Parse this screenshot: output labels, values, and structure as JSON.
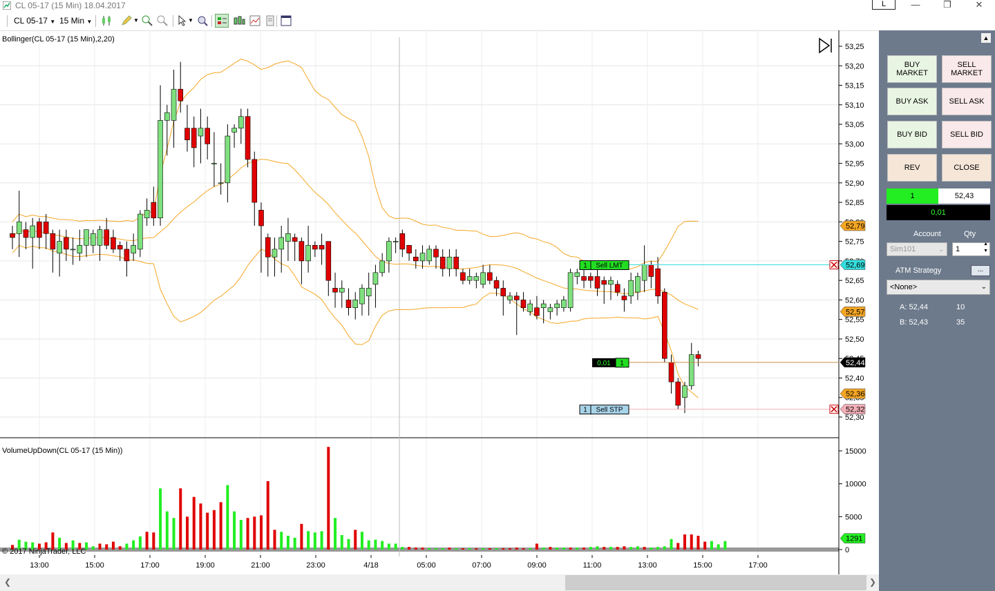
{
  "window": {
    "title": "CL 05-17 (15 Min)  18.04.2017",
    "layout_button": "L",
    "controls": [
      "minimize",
      "maximize",
      "close"
    ]
  },
  "toolbar": {
    "instrument": "CL 05-17",
    "interval": "15 Min",
    "icons": [
      "candlestick-icon",
      "pencil-icon",
      "zoom-in-icon",
      "zoom-out-icon",
      "cursor-icon",
      "magnifier-icon",
      "chart-trader-icon",
      "bars-icon",
      "chart-style-icon",
      "properties-icon",
      "panel-icon"
    ]
  },
  "chart": {
    "price_indicator_label": "Bollinger(CL 05-17 (15 Min),2,20)",
    "volume_indicator_label": "VolumeUpDown(CL 05-17 (15 Min))",
    "copyright": "© 2017 NinjaTrader, LLC",
    "price_ticks": [
      "53,25",
      "53,20",
      "53,15",
      "53,10",
      "53,05",
      "53,00",
      "52,95",
      "52,90",
      "52,85",
      "52,80",
      "52,75",
      "52,70",
      "52,65",
      "52,60",
      "52,55",
      "52,50",
      "52,45",
      "52,40",
      "52,35",
      "52,30"
    ],
    "volume_ticks": [
      "15000",
      "10000",
      "5000",
      "0"
    ],
    "time_ticks": [
      "13:00",
      "15:00",
      "17:00",
      "19:00",
      "21:00",
      "23:00",
      "4/18",
      "05:00",
      "07:00",
      "09:00",
      "11:00",
      "13:00",
      "15:00",
      "17:00"
    ],
    "price_markers": {
      "upper_band": "52,79",
      "sell_limit": "52,69",
      "middle_band": "52,57",
      "last_price": "52,44",
      "lower_band": "52,36",
      "sell_stop": "52,32",
      "volume_last": "1291"
    },
    "orders": {
      "sell_limit": {
        "qty": "1",
        "label": "Sell LMT"
      },
      "sell_stop": {
        "qty": "1",
        "label": "Sell STP"
      },
      "position": {
        "pnl": "0,01",
        "qty": "1"
      }
    },
    "colors": {
      "up": "#7ee07e",
      "down": "#e00000",
      "band": "#f5a623",
      "limit_line": "#33dddd",
      "stop_line": "#f4b0b8",
      "position_line": "#c88a4a"
    }
  },
  "chart_data": {
    "type": "candlestick",
    "price_range": [
      52.27,
      53.29
    ],
    "candles": [
      [
        52.77,
        52.79,
        52.73,
        52.76
      ],
      [
        52.77,
        52.88,
        52.71,
        52.8
      ],
      [
        52.78,
        52.8,
        52.73,
        52.76
      ],
      [
        52.76,
        52.81,
        52.68,
        52.79
      ],
      [
        52.8,
        52.81,
        52.73,
        52.76
      ],
      [
        52.8,
        52.82,
        52.73,
        52.77
      ],
      [
        52.77,
        52.78,
        52.67,
        52.73
      ],
      [
        52.72,
        52.78,
        52.66,
        52.75
      ],
      [
        52.76,
        52.78,
        52.7,
        52.73
      ],
      [
        52.73,
        52.76,
        52.69,
        52.73
      ],
      [
        52.72,
        52.78,
        52.7,
        52.74
      ],
      [
        52.74,
        52.78,
        52.71,
        52.78
      ],
      [
        52.74,
        52.78,
        52.72,
        52.77
      ],
      [
        52.74,
        52.79,
        52.7,
        52.78
      ],
      [
        52.78,
        52.81,
        52.73,
        52.74
      ],
      [
        52.76,
        52.78,
        52.72,
        52.73
      ],
      [
        52.74,
        52.75,
        52.7,
        52.73
      ],
      [
        52.73,
        52.75,
        52.66,
        52.7
      ],
      [
        52.72,
        52.77,
        52.7,
        52.74
      ],
      [
        52.73,
        52.83,
        52.71,
        52.82
      ],
      [
        52.81,
        52.86,
        52.79,
        52.83
      ],
      [
        52.85,
        52.89,
        52.79,
        52.81
      ],
      [
        52.81,
        53.15,
        52.79,
        53.06
      ],
      [
        53.06,
        53.1,
        52.97,
        53.08
      ],
      [
        53.06,
        53.19,
        52.99,
        53.14
      ],
      [
        53.14,
        53.21,
        53.08,
        53.11
      ],
      [
        53.04,
        53.1,
        52.98,
        53.01
      ],
      [
        53.04,
        53.07,
        52.94,
        52.99
      ],
      [
        53.02,
        53.09,
        52.95,
        53.04
      ],
      [
        53.04,
        53.07,
        52.96,
        53.0
      ],
      [
        52.95,
        53.03,
        52.89,
        52.95
      ],
      [
        52.9,
        52.95,
        52.87,
        52.9
      ],
      [
        52.9,
        53.05,
        52.85,
        53.02
      ],
      [
        53.03,
        53.05,
        52.99,
        53.04
      ],
      [
        53.04,
        53.09,
        53.0,
        53.07
      ],
      [
        53.07,
        53.09,
        52.94,
        52.96
      ],
      [
        52.96,
        52.98,
        52.79,
        52.85
      ],
      [
        52.83,
        52.85,
        52.67,
        52.79
      ],
      [
        52.76,
        52.77,
        52.66,
        52.71
      ],
      [
        52.71,
        52.76,
        52.66,
        52.73
      ],
      [
        52.73,
        52.79,
        52.67,
        52.76
      ],
      [
        52.75,
        52.81,
        52.7,
        52.77
      ],
      [
        52.76,
        52.77,
        52.7,
        52.75
      ],
      [
        52.75,
        52.76,
        52.64,
        52.7
      ],
      [
        52.7,
        52.79,
        52.67,
        52.74
      ],
      [
        52.74,
        52.75,
        52.71,
        52.73
      ],
      [
        52.74,
        52.77,
        52.69,
        52.73
      ],
      [
        52.75,
        52.75,
        52.61,
        52.65
      ],
      [
        52.63,
        52.67,
        52.58,
        52.62
      ],
      [
        52.62,
        52.65,
        52.58,
        52.63
      ],
      [
        52.6,
        52.63,
        52.56,
        52.58
      ],
      [
        52.58,
        52.62,
        52.55,
        52.6
      ],
      [
        52.59,
        52.64,
        52.56,
        52.63
      ],
      [
        52.61,
        52.67,
        52.56,
        52.63
      ],
      [
        52.64,
        52.69,
        52.58,
        52.67
      ],
      [
        52.67,
        52.72,
        52.66,
        52.7
      ],
      [
        52.7,
        52.76,
        52.67,
        52.75
      ],
      [
        52.75,
        52.76,
        52.72,
        52.75
      ],
      [
        52.77,
        52.78,
        52.71,
        52.73
      ],
      [
        52.74,
        52.74,
        52.7,
        52.72
      ],
      [
        52.71,
        52.73,
        52.68,
        52.7
      ],
      [
        52.7,
        52.74,
        52.68,
        52.72
      ],
      [
        52.7,
        52.74,
        52.69,
        52.73
      ],
      [
        52.73,
        52.74,
        52.68,
        52.71
      ],
      [
        52.71,
        52.73,
        52.66,
        52.68
      ],
      [
        52.68,
        52.73,
        52.66,
        52.71
      ],
      [
        52.71,
        52.73,
        52.66,
        52.68
      ],
      [
        52.67,
        52.68,
        52.64,
        52.65
      ],
      [
        52.65,
        52.68,
        52.64,
        52.66
      ],
      [
        52.65,
        52.67,
        52.63,
        52.66
      ],
      [
        52.64,
        52.69,
        52.63,
        52.67
      ],
      [
        52.67,
        52.69,
        52.64,
        52.65
      ],
      [
        52.65,
        52.66,
        52.61,
        52.63
      ],
      [
        52.63,
        52.65,
        52.56,
        52.61
      ],
      [
        52.6,
        52.62,
        52.59,
        52.61
      ],
      [
        52.61,
        52.62,
        52.51,
        52.6
      ],
      [
        52.6,
        52.62,
        52.57,
        52.58
      ],
      [
        52.57,
        52.6,
        52.56,
        52.59
      ],
      [
        52.58,
        52.61,
        52.55,
        52.56
      ],
      [
        52.58,
        52.6,
        52.54,
        52.59
      ],
      [
        52.57,
        52.59,
        52.55,
        52.58
      ],
      [
        52.58,
        52.6,
        52.56,
        52.59
      ],
      [
        52.58,
        52.61,
        52.57,
        52.6
      ],
      [
        52.58,
        52.68,
        52.57,
        52.67
      ],
      [
        52.66,
        52.68,
        52.64,
        52.67
      ],
      [
        52.66,
        52.68,
        52.63,
        52.65
      ],
      [
        52.66,
        52.67,
        52.63,
        52.65
      ],
      [
        52.66,
        52.68,
        52.61,
        52.63
      ],
      [
        52.65,
        52.66,
        52.59,
        52.64
      ],
      [
        52.64,
        52.66,
        52.6,
        52.65
      ],
      [
        52.64,
        52.65,
        52.61,
        52.62
      ],
      [
        52.61,
        52.63,
        52.57,
        52.6
      ],
      [
        52.61,
        52.67,
        52.59,
        52.65
      ],
      [
        52.62,
        52.67,
        52.6,
        52.66
      ],
      [
        52.65,
        52.74,
        52.62,
        52.69
      ],
      [
        52.69,
        52.7,
        52.63,
        52.66
      ],
      [
        52.68,
        52.71,
        52.59,
        52.61
      ],
      [
        52.62,
        52.63,
        52.44,
        52.45
      ],
      [
        52.44,
        52.46,
        52.36,
        52.39
      ],
      [
        52.39,
        52.4,
        52.32,
        52.33
      ],
      [
        52.35,
        52.39,
        52.31,
        52.38
      ],
      [
        52.38,
        52.49,
        52.37,
        52.46
      ],
      [
        52.46,
        52.47,
        52.43,
        52.45
      ]
    ],
    "bollinger": {
      "period": 20,
      "std": 2
    },
    "volume": [
      {
        "v": 700,
        "up": false
      },
      {
        "v": 1500,
        "up": true
      },
      {
        "v": 1200,
        "up": true
      },
      {
        "v": 1100,
        "up": true
      },
      {
        "v": 900,
        "up": false
      },
      {
        "v": 1100,
        "up": false
      },
      {
        "v": 2600,
        "up": false
      },
      {
        "v": 1800,
        "up": true
      },
      {
        "v": 1000,
        "up": false
      },
      {
        "v": 1400,
        "up": true
      },
      {
        "v": 1000,
        "up": false
      },
      {
        "v": 1100,
        "up": true
      },
      {
        "v": 500,
        "up": true
      },
      {
        "v": 900,
        "up": false
      },
      {
        "v": 800,
        "up": false
      },
      {
        "v": 1200,
        "up": false
      },
      {
        "v": 500,
        "up": false
      },
      {
        "v": 900,
        "up": true
      },
      {
        "v": 1400,
        "up": true
      },
      {
        "v": 2000,
        "up": true
      },
      {
        "v": 2700,
        "up": false
      },
      {
        "v": 2600,
        "up": false
      },
      {
        "v": 9300,
        "up": true
      },
      {
        "v": 5800,
        "up": true
      },
      {
        "v": 4800,
        "up": true
      },
      {
        "v": 9300,
        "up": false
      },
      {
        "v": 5000,
        "up": false
      },
      {
        "v": 8000,
        "up": false
      },
      {
        "v": 7000,
        "up": false
      },
      {
        "v": 5600,
        "up": false
      },
      {
        "v": 6000,
        "up": false
      },
      {
        "v": 7200,
        "up": false
      },
      {
        "v": 9800,
        "up": true
      },
      {
        "v": 5800,
        "up": true
      },
      {
        "v": 4500,
        "up": true
      },
      {
        "v": 4800,
        "up": false
      },
      {
        "v": 5000,
        "up": false
      },
      {
        "v": 5200,
        "up": false
      },
      {
        "v": 10400,
        "up": false
      },
      {
        "v": 3000,
        "up": false
      },
      {
        "v": 2700,
        "up": true
      },
      {
        "v": 2100,
        "up": true
      },
      {
        "v": 1800,
        "up": true
      },
      {
        "v": 3900,
        "up": false
      },
      {
        "v": 2800,
        "up": true
      },
      {
        "v": 2600,
        "up": true
      },
      {
        "v": 2800,
        "up": true
      },
      {
        "v": 15600,
        "up": false
      },
      {
        "v": 4800,
        "up": true
      },
      {
        "v": 2200,
        "up": true
      },
      {
        "v": 1600,
        "up": true
      },
      {
        "v": 3000,
        "up": false
      },
      {
        "v": 2700,
        "up": true
      },
      {
        "v": 1400,
        "up": true
      },
      {
        "v": 1500,
        "up": true
      },
      {
        "v": 1300,
        "up": true
      },
      {
        "v": 900,
        "up": true
      },
      {
        "v": 900,
        "up": true
      },
      {
        "v": 400,
        "up": true
      },
      {
        "v": 400,
        "up": false
      },
      {
        "v": 300,
        "up": false
      },
      {
        "v": 300,
        "up": false
      },
      {
        "v": 200,
        "up": true
      },
      {
        "v": 200,
        "up": true
      },
      {
        "v": 200,
        "up": true
      },
      {
        "v": 300,
        "up": false
      },
      {
        "v": 200,
        "up": true
      },
      {
        "v": 200,
        "up": false
      },
      {
        "v": 200,
        "up": true
      },
      {
        "v": 200,
        "up": false
      },
      {
        "v": 200,
        "up": true
      },
      {
        "v": 200,
        "up": false
      },
      {
        "v": 200,
        "up": true
      },
      {
        "v": 200,
        "up": false
      },
      {
        "v": 200,
        "up": false
      },
      {
        "v": 300,
        "up": false
      },
      {
        "v": 200,
        "up": false
      },
      {
        "v": 200,
        "up": true
      },
      {
        "v": 900,
        "up": false
      },
      {
        "v": 300,
        "up": true
      },
      {
        "v": 400,
        "up": false
      },
      {
        "v": 300,
        "up": true
      },
      {
        "v": 300,
        "up": true
      },
      {
        "v": 300,
        "up": false
      },
      {
        "v": 300,
        "up": true
      },
      {
        "v": 300,
        "up": false
      },
      {
        "v": 400,
        "up": true
      },
      {
        "v": 500,
        "up": true
      },
      {
        "v": 400,
        "up": false
      },
      {
        "v": 400,
        "up": true
      },
      {
        "v": 400,
        "up": false
      },
      {
        "v": 500,
        "up": false
      },
      {
        "v": 400,
        "up": true
      },
      {
        "v": 500,
        "up": true
      },
      {
        "v": 400,
        "up": false
      },
      {
        "v": 300,
        "up": true
      },
      {
        "v": 400,
        "up": true
      },
      {
        "v": 500,
        "up": true
      },
      {
        "v": 1600,
        "up": true
      },
      {
        "v": 1000,
        "up": false
      },
      {
        "v": 2300,
        "up": false
      },
      {
        "v": 2300,
        "up": false
      },
      {
        "v": 2100,
        "up": false
      },
      {
        "v": 1200,
        "up": false
      },
      {
        "v": 1300,
        "up": true
      },
      {
        "v": 800,
        "up": true
      },
      {
        "v": 1291,
        "up": true
      }
    ]
  },
  "panel": {
    "buttons": {
      "buy_market": "BUY\nMARKET",
      "sell_market": "SELL\nMARKET",
      "buy_ask": "BUY ASK",
      "sell_ask": "SELL ASK",
      "buy_bid": "BUY BID",
      "sell_bid": "SELL BID",
      "rev": "REV",
      "close": "CLOSE"
    },
    "position_qty": "1",
    "position_price": "52,43",
    "pnl": "0,01",
    "account_label": "Account",
    "qty_label": "Qty",
    "account": "Sim101",
    "qty": "1",
    "atm_label": "ATM Strategy",
    "atm_button": "...",
    "atm_value": "<None>",
    "ask_label": "A: 52,44",
    "ask_size": "10",
    "bid_label": "B: 52,43",
    "bid_size": "35"
  }
}
